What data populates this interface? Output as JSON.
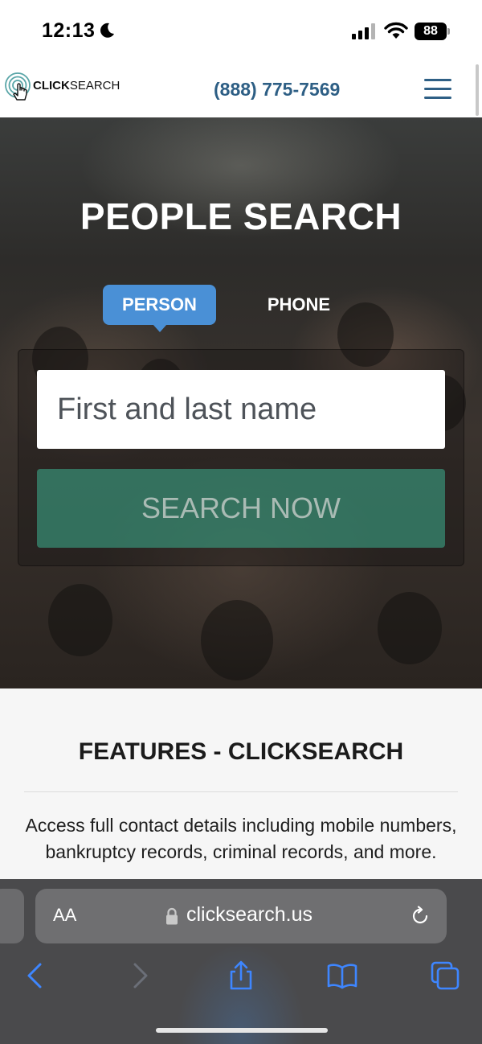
{
  "status_bar": {
    "time": "12:13",
    "battery": "88",
    "icons": [
      "moon-icon",
      "signal-icon",
      "wifi-icon",
      "battery-icon"
    ]
  },
  "header": {
    "logo_click": "CLICK",
    "logo_search": "SEARCH",
    "phone": "(888) 775-7569",
    "menu_icon": "hamburger-menu-icon",
    "colors": {
      "accent": "#2e5f85"
    }
  },
  "hero": {
    "title": "PEOPLE SEARCH",
    "tabs": [
      {
        "label": "PERSON",
        "active": true
      },
      {
        "label": "PHONE",
        "active": false
      }
    ],
    "input_placeholder": "First and last name",
    "search_button": "SEARCH NOW",
    "colors": {
      "tab_active": "#4a90d6",
      "button": "#3aa082"
    }
  },
  "features": {
    "title": "FEATURES - CLICKSEARCH",
    "text": "Access full contact details including mobile numbers, bankruptcy records, criminal records, and more."
  },
  "browser": {
    "text_size_label": "AA",
    "url": "clicksearch.us",
    "icons": [
      "lock-icon",
      "reload-icon",
      "back-icon",
      "forward-icon",
      "share-icon",
      "bookmarks-icon",
      "tabs-icon"
    ],
    "colors": {
      "toolbar_icons": "#3e86ff"
    }
  }
}
